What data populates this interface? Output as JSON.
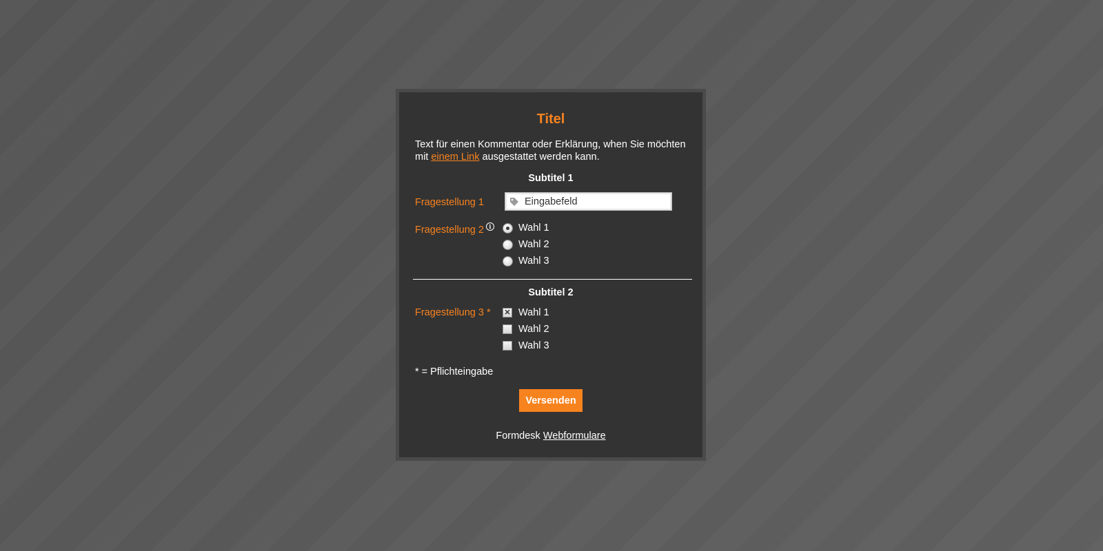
{
  "form": {
    "title": "Titel",
    "intro_before": "Text für einen Kommentar oder Erklärung, when Sie möchten mit ",
    "intro_link": "einem Link",
    "intro_after": " ausgestattet werden kann.",
    "subtitle1": "Subtitel 1",
    "q1_label": "Fragestellung 1",
    "q1_input_value": "Eingabefeld",
    "q2_label": "Fragestellung 2",
    "q2_info_glyph": "i",
    "q2_options": [
      "Wahl 1",
      "Wahl 2",
      "Wahl 3"
    ],
    "q2_selected": "Wahl 1",
    "subtitle2": "Subtitel 2",
    "q3_label": "Fragestellung 3 *",
    "q3_options": [
      "Wahl 1",
      "Wahl 2",
      "Wahl 3"
    ],
    "q3_checked": [
      "Wahl 1"
    ],
    "q3_check_glyph": "✕",
    "required_note": "* = Pflichteingabe",
    "submit_label": "Versenden",
    "footer_text": "Formdesk ",
    "footer_link": "Webformulare"
  },
  "colors": {
    "accent": "#f7831f",
    "card": "#333333",
    "background": "#5a5a5a"
  }
}
